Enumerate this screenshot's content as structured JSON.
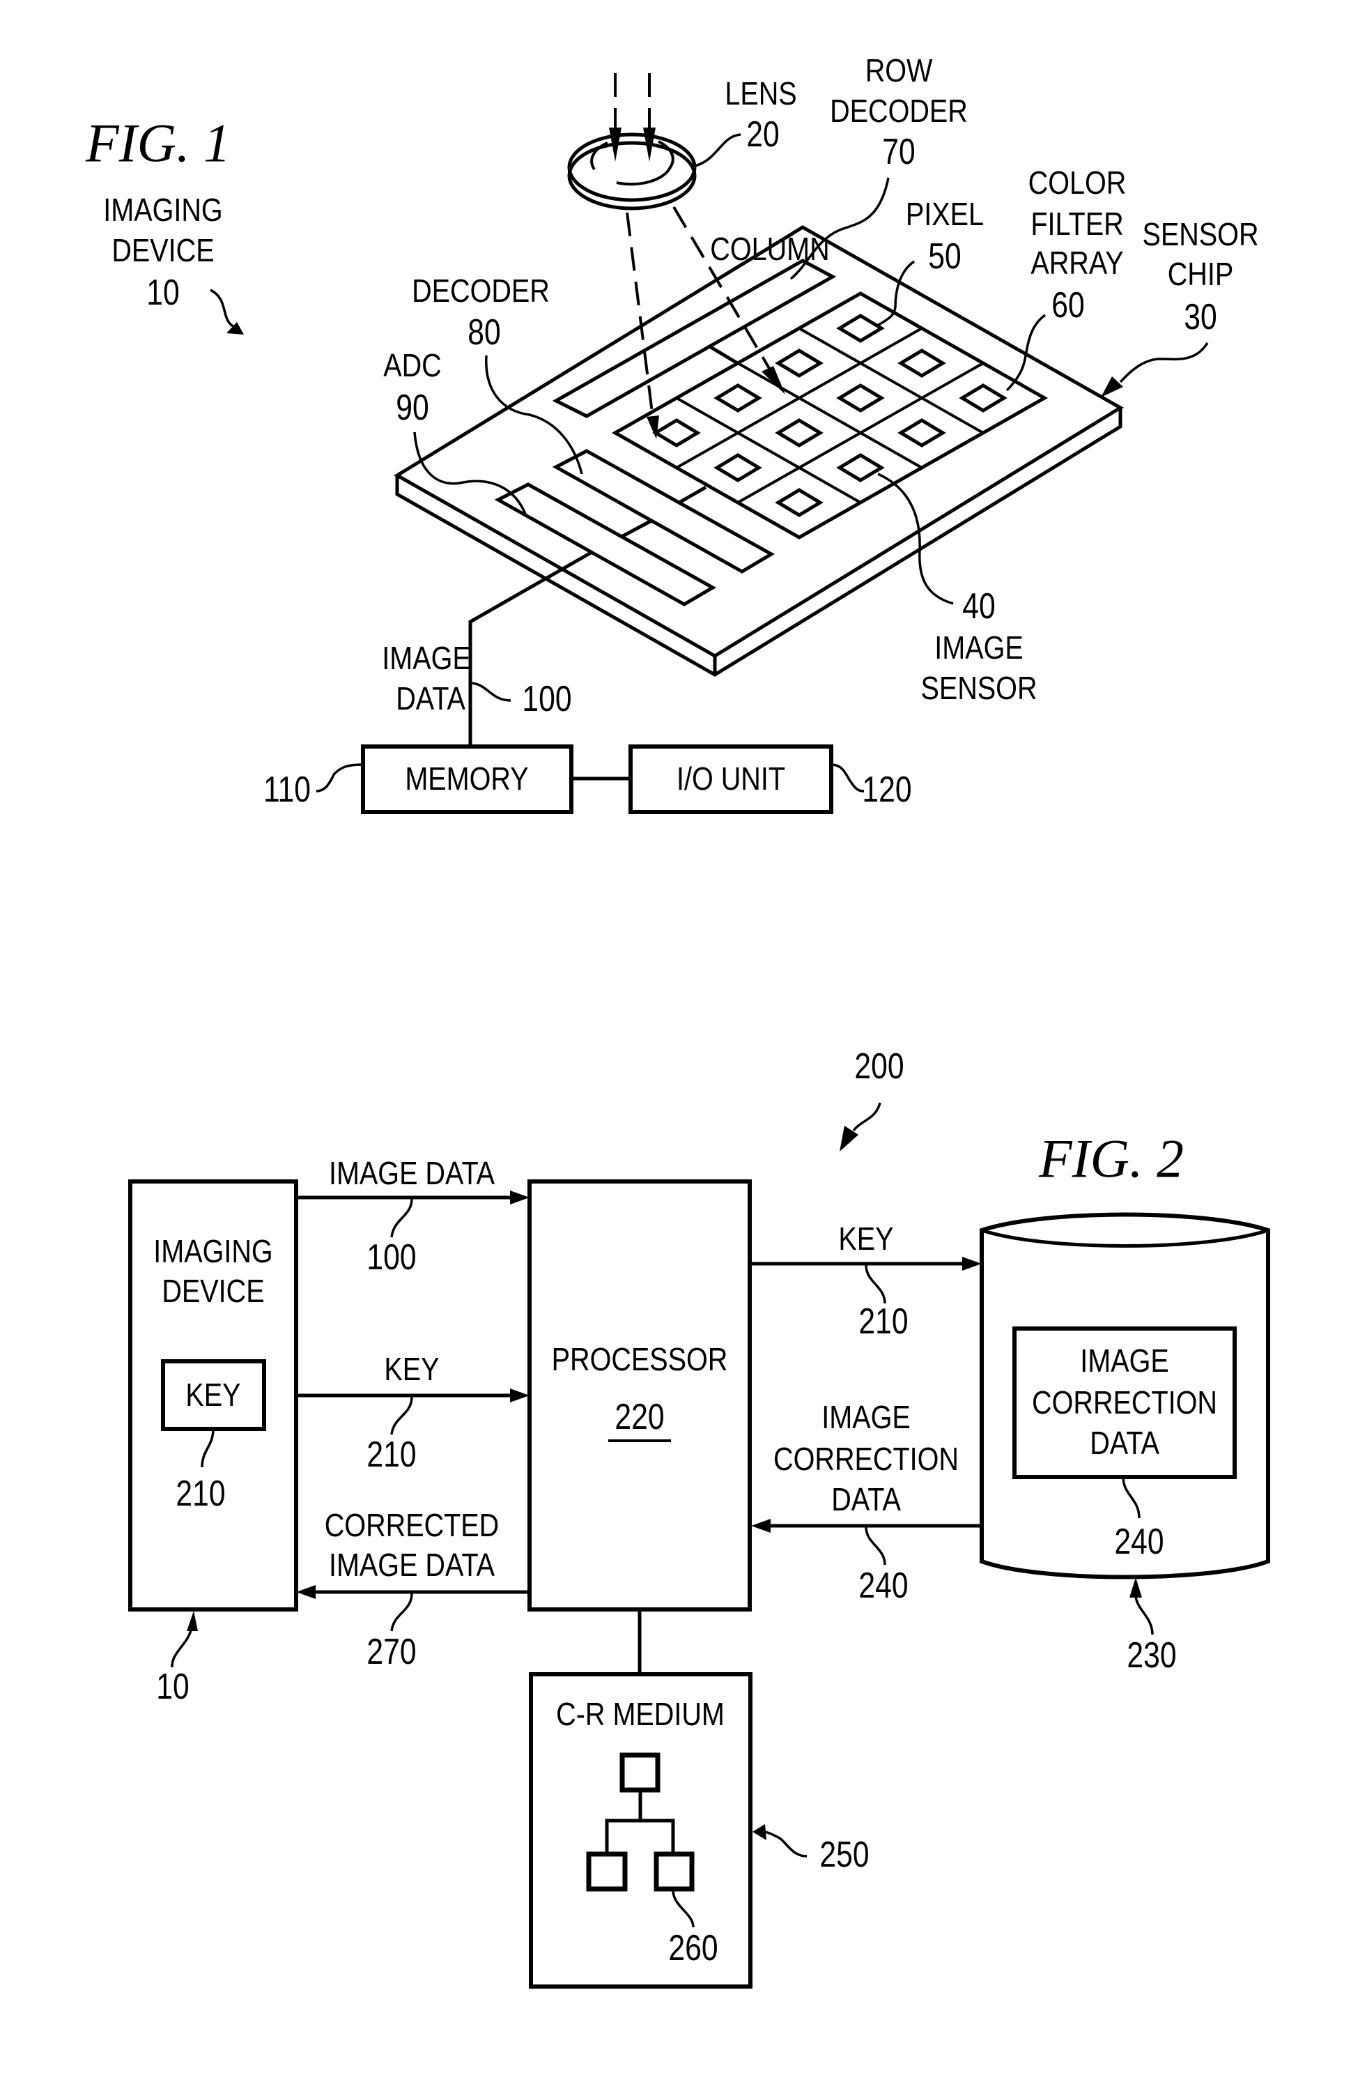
{
  "figure1": {
    "title": "FIG. 1",
    "imaging_device": {
      "line1": "IMAGING",
      "line2": "DEVICE",
      "ref": "10"
    },
    "lens": {
      "label": "LENS",
      "ref": "20"
    },
    "row_decoder": {
      "line1": "ROW",
      "line2": "DECODER",
      "ref": "70"
    },
    "column_decoder": {
      "line1": "COLUMN",
      "line2": "DECODER",
      "ref": "80"
    },
    "adc": {
      "label": "ADC",
      "ref": "90"
    },
    "pixel": {
      "label": "PIXEL",
      "ref": "50"
    },
    "color_filter_array": {
      "line1": "COLOR",
      "line2": "FILTER",
      "line3": "ARRAY",
      "ref": "60"
    },
    "sensor_chip": {
      "line1": "SENSOR",
      "line2": "CHIP",
      "ref": "30"
    },
    "image_sensor": {
      "ref": "40",
      "line1": "IMAGE",
      "line2": "SENSOR"
    },
    "image_data": {
      "line1": "IMAGE",
      "line2": "DATA",
      "ref": "100"
    },
    "memory": {
      "label": "MEMORY",
      "ref": "110"
    },
    "io_unit": {
      "label": "I/O UNIT",
      "ref": "120"
    },
    "pixel_grid": {
      "rows": 4,
      "cols": 3
    }
  },
  "figure2": {
    "title": "FIG. 2",
    "system_ref": "200",
    "imaging_device": {
      "line1": "IMAGING",
      "line2": "DEVICE",
      "ref": "10",
      "key_label": "KEY",
      "key_ref": "210"
    },
    "processor": {
      "label": "PROCESSOR",
      "ref": "220"
    },
    "database": {
      "ref": "230",
      "inner_line1": "IMAGE",
      "inner_line2": "CORRECTION",
      "inner_line3": "DATA",
      "inner_ref": "240"
    },
    "cr_medium": {
      "label": "C-R MEDIUM",
      "ref": "250",
      "program_ref": "260"
    },
    "signals": {
      "image_data": {
        "label": "IMAGE DATA",
        "ref": "100"
      },
      "key_to_processor": {
        "label": "KEY",
        "ref": "210"
      },
      "corrected": {
        "line1": "CORRECTED",
        "line2": "IMAGE DATA",
        "ref": "270"
      },
      "key_to_db": {
        "label": "KEY",
        "ref": "210"
      },
      "correction": {
        "line1": "IMAGE",
        "line2": "CORRECTION",
        "line3": "DATA",
        "ref": "240"
      }
    }
  }
}
